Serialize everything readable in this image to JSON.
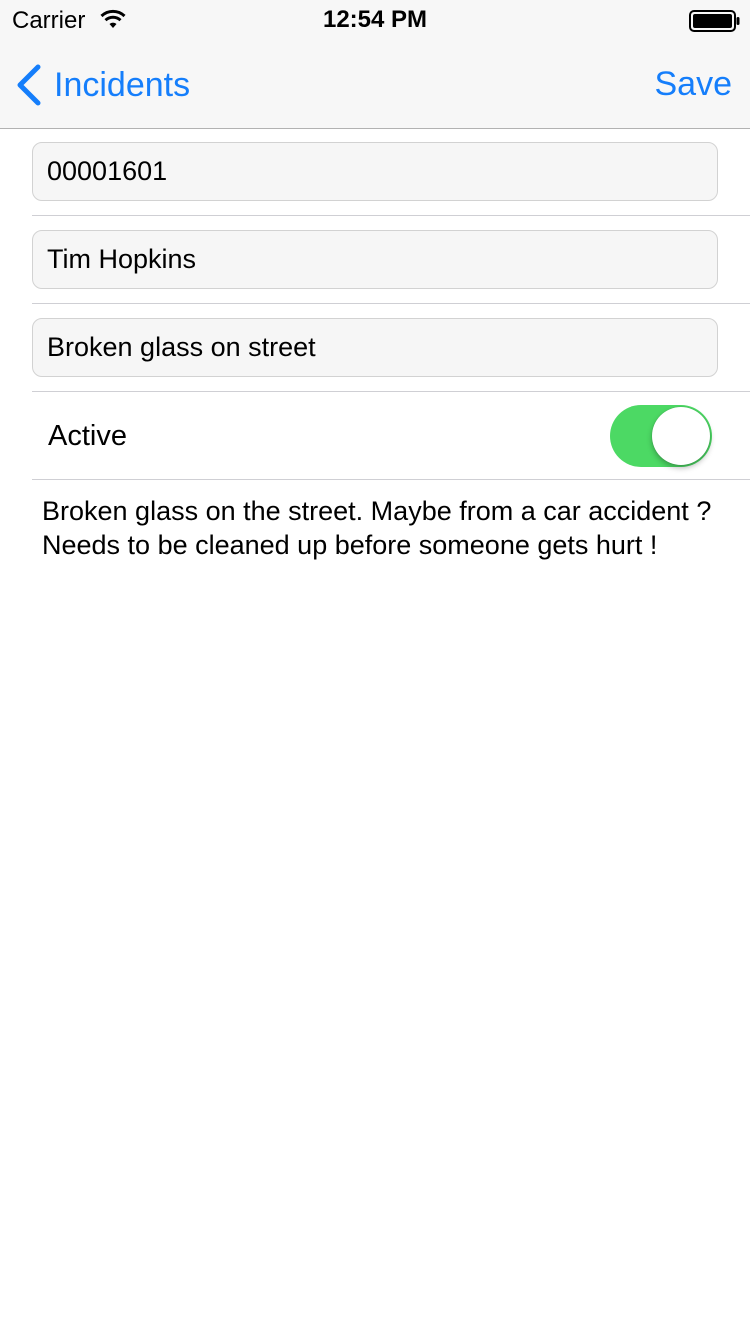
{
  "status_bar": {
    "carrier": "Carrier",
    "time": "12:54 PM",
    "icons": [
      "wifi-icon",
      "battery-icon"
    ]
  },
  "nav": {
    "back_label": "Incidents",
    "back_icon": "chevron-left-icon",
    "save_label": "Save",
    "accent_color": "#157efb"
  },
  "form": {
    "incident_number": "00001601",
    "reporter_name": "Tim Hopkins",
    "subject": "Broken glass on street",
    "active_label": "Active",
    "active": true,
    "active_color": "#4cd964",
    "description": "Broken glass on the street. Maybe from a car accident ? Needs to be cleaned up before someone gets hurt !"
  }
}
